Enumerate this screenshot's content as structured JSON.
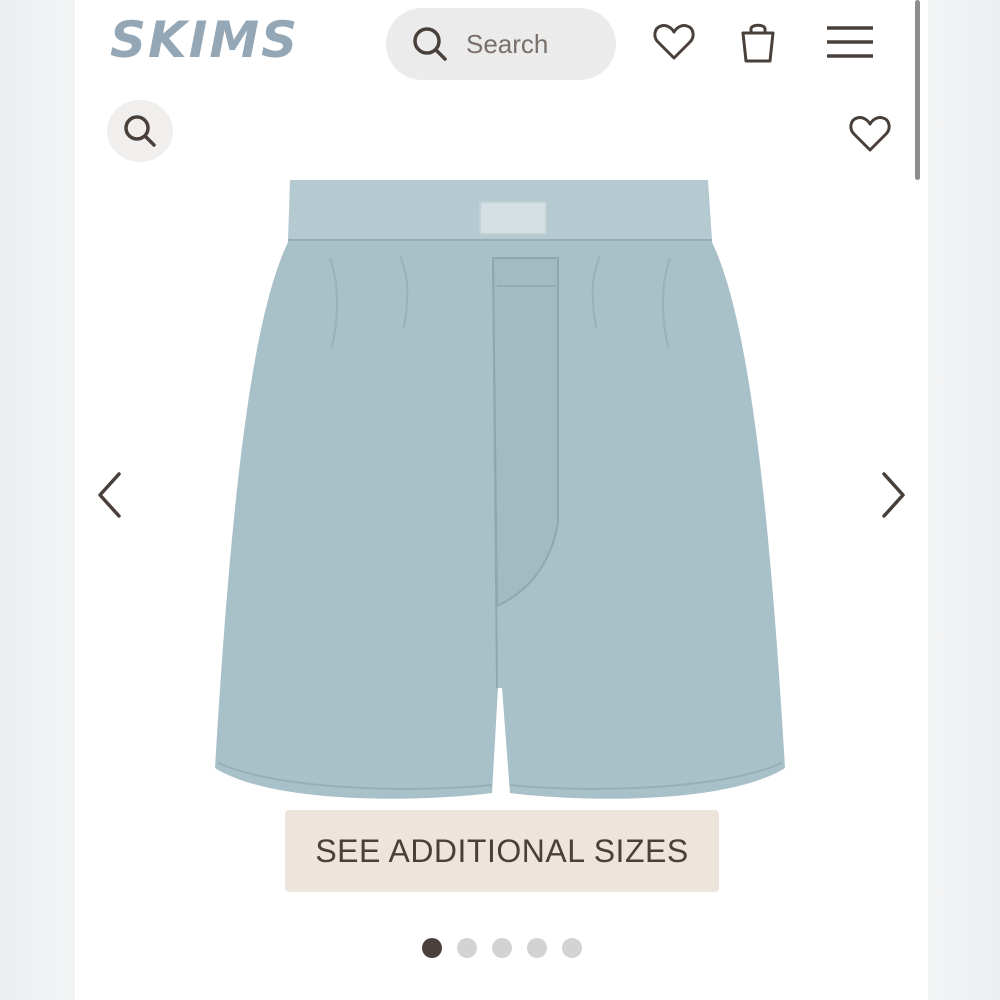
{
  "header": {
    "logo_text": "SKIMS",
    "search_label": "Search"
  },
  "gallery": {
    "current_index": 1,
    "total_images": 5,
    "see_sizes_label": "SEE ADDITIONAL SIZES",
    "product_color": "#a8c0c8"
  },
  "colors": {
    "brand": "#93a7b6",
    "icon": "#4a403b",
    "button_bg": "#ede5dc",
    "dot_inactive": "#d3d3d3"
  },
  "icons": [
    "search-icon",
    "heart-icon",
    "shopping-bag-icon",
    "menu-icon",
    "zoom-icon",
    "favorite-icon",
    "chevron-left-icon",
    "chevron-right-icon"
  ]
}
